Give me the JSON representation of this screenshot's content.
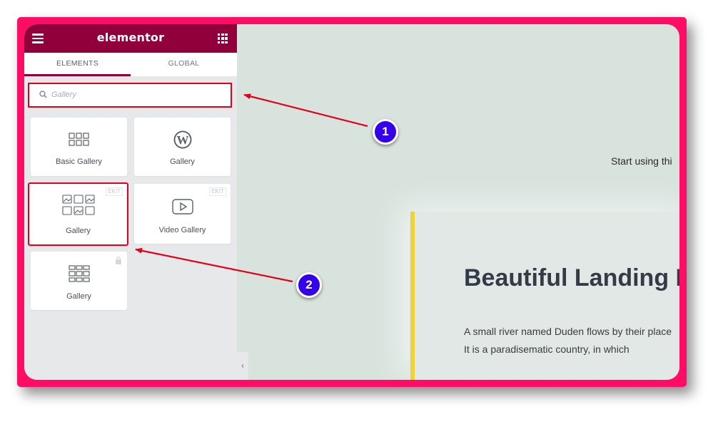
{
  "app": {
    "brand": "elementor"
  },
  "tabs": [
    {
      "label": "ELEMENTS",
      "active": true
    },
    {
      "label": "GLOBAL",
      "active": false
    }
  ],
  "search": {
    "placeholder": "Gallery"
  },
  "widgets": [
    {
      "label": "Basic Gallery",
      "icon": "basic-gallery-icon"
    },
    {
      "label": "Gallery",
      "icon": "wordpress-icon"
    },
    {
      "label": "Gallery",
      "icon": "image-gallery-icon",
      "badge": "EKIT"
    },
    {
      "label": "Video Gallery",
      "icon": "video-play-icon",
      "badge": "EKIT"
    },
    {
      "label": "Gallery",
      "icon": "gallery-grid-icon",
      "locked": true
    }
  ],
  "canvas": {
    "intro_text": "Start using thi",
    "heading": "Beautiful Landing P",
    "paragraph_line1": "A small river named Duden flows by their place",
    "paragraph_line2": "It is a paradisematic country, in which"
  },
  "annotations": [
    {
      "label": "1"
    },
    {
      "label": "2"
    }
  ],
  "colors": {
    "frame": "#fd0d66",
    "elementor_brand": "#92003b",
    "highlight": "#e3001b",
    "marker": "#3500ea",
    "accent_bar": "#f3d233"
  }
}
